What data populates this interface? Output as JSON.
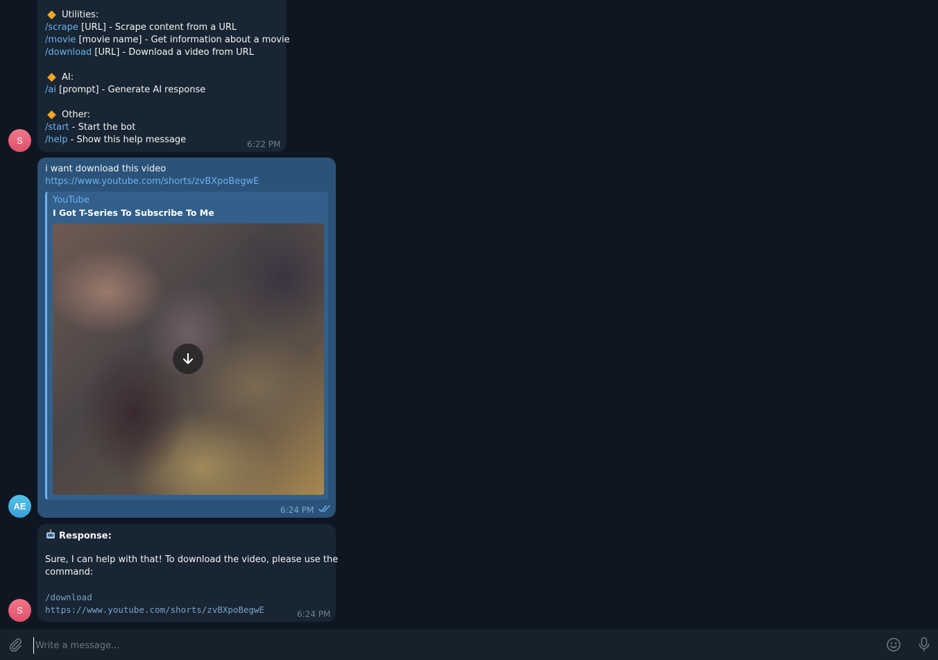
{
  "messages": {
    "help": {
      "sections": [
        {
          "title": "Utilities:",
          "lines": [
            {
              "cmd": "/scrape",
              "text": " [URL] - Scrape content from a URL"
            },
            {
              "cmd": "/movie",
              "text": " [movie name] - Get information about a movie"
            },
            {
              "cmd": "/download",
              "text": " [URL] - Download a video from URL"
            }
          ]
        },
        {
          "title": "AI:",
          "lines": [
            {
              "cmd": "/ai",
              "text": " [prompt] - Generate AI response"
            }
          ]
        },
        {
          "title": "Other:",
          "lines": [
            {
              "cmd": "/start",
              "text": " - Start the bot"
            },
            {
              "cmd": "/help",
              "text": " - Show this help message"
            }
          ]
        }
      ],
      "time": "6:22 PM",
      "avatar": "S"
    },
    "user": {
      "text": "i want download this video",
      "link": "https://www.youtube.com/shorts/zvBXpoBegwE",
      "preview_site": "YouTube",
      "preview_title": "I Got T-Series To Subscribe To Me",
      "time": "6:24 PM",
      "avatar": "AE"
    },
    "response": {
      "label": "Response:",
      "text_line1": "Sure, I can help with that! To download the video, please use the",
      "text_line2": "command:",
      "code_line1": "/download",
      "code_line2": "https://www.youtube.com/shorts/zvBXpoBegwE",
      "time": "6:24 PM",
      "avatar": "S"
    }
  },
  "composer": {
    "placeholder": "Write a message..."
  },
  "icons": [
    "diamond-icon",
    "robot-icon",
    "download-arrow-icon",
    "double-check-icon",
    "paperclip-icon",
    "emoji-icon",
    "microphone-icon"
  ],
  "colors": {
    "background": "#0e1621",
    "incoming": "#182533",
    "outgoing": "#2b5278",
    "link": "#6ab2f2",
    "accent": "#f5a623"
  }
}
